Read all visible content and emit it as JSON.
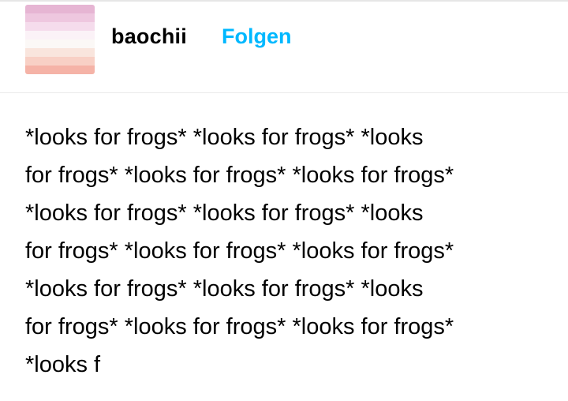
{
  "header": {
    "username": "baochii",
    "follow_label": "Folgen"
  },
  "avatar": {
    "icon": "avatar-striped-flag",
    "colors": [
      "#e6b5d3",
      "#eec7df",
      "#f5dcec",
      "#fbf2f7",
      "#fbf8f6",
      "#f9e5dd",
      "#f8d0c5",
      "#f5b3a7"
    ]
  },
  "post": {
    "lines": [
      "*looks for frogs* *looks for frogs* *looks",
      "for frogs* *looks for frogs* *looks for frogs*",
      "*looks for frogs* *looks for frogs* *looks",
      "for frogs* *looks for frogs* *looks for frogs*",
      "*looks for frogs* *looks for frogs* *looks",
      "for frogs* *looks for frogs* *looks for frogs*",
      "*looks f"
    ]
  },
  "colors": {
    "follow": "#00b8ff",
    "text": "#000000"
  }
}
